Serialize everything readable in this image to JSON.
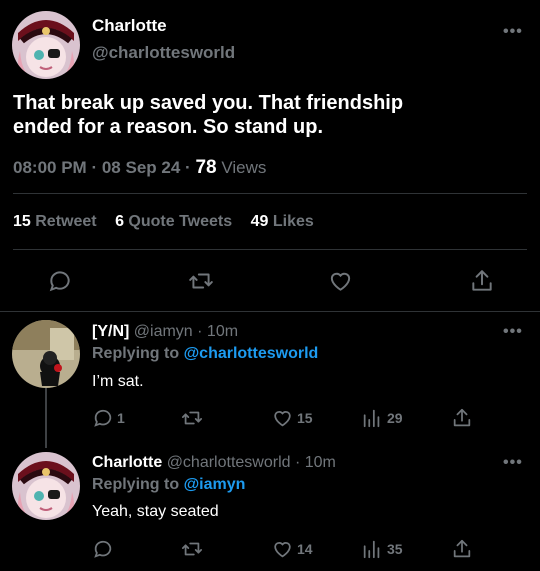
{
  "main_tweet": {
    "author_name": "Charlotte",
    "handle": "@charlottesworld",
    "text_line1": "That break up saved you. That friendship",
    "text_line2": "ended for a reason. So stand up.",
    "time": "08:00 PM",
    "sep1": "·",
    "date": "08 Sep 24",
    "sep2": "·",
    "views_count": "78",
    "views_label": "Views",
    "retweets_count": "15",
    "retweets_label": "Retweet",
    "quotes_count": "6",
    "quotes_label": "Quote Tweets",
    "likes_count": "49",
    "likes_label": "Likes",
    "more": "•••"
  },
  "reply1": {
    "author_name": "[Y/N]",
    "handle": "@iamyn",
    "time": "· 10m",
    "replying_label": "Replying to",
    "replying_handle": "@charlottesworld",
    "text": "I’m sat.",
    "reply_count": "1",
    "like_count": "15",
    "view_count": "29",
    "more": "•••"
  },
  "reply2": {
    "author_name": "Charlotte",
    "handle": "@charlottesworld",
    "time": "· 10m",
    "replying_label": "Replying to",
    "replying_handle": "@iamyn",
    "text": "Yeah, stay seated",
    "like_count": "14",
    "view_count": "35",
    "more": "•••"
  },
  "colors": {
    "background": "#000000",
    "accent": "#1d9bf0",
    "muted": "#71767b",
    "divider": "#2f3336"
  },
  "icons": [
    "reply-icon",
    "retweet-icon",
    "like-icon",
    "share-icon",
    "views-icon",
    "more-icon"
  ]
}
